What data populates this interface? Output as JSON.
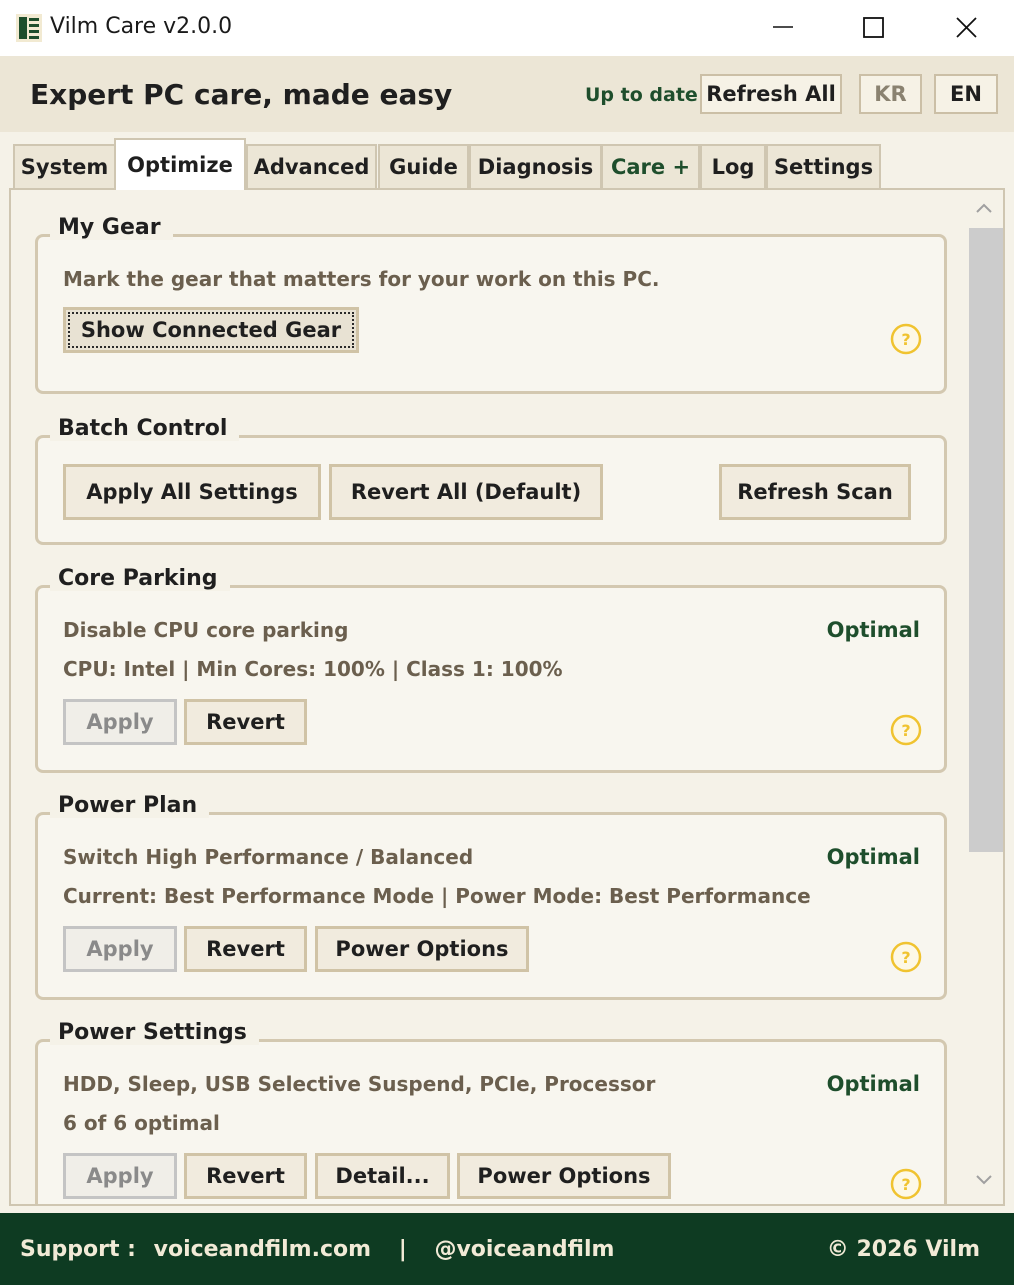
{
  "window": {
    "title": "Vilm Care v2.0.0",
    "app_icon": "vilm-logo-icon",
    "controls": [
      "minimize-icon",
      "maximize-icon",
      "close-icon"
    ]
  },
  "header": {
    "tagline": "Expert PC care, made easy",
    "status": "Up to date",
    "refresh_label": "Refresh All",
    "lang_kr": "KR",
    "lang_en": "EN"
  },
  "tabs": [
    {
      "label": "System",
      "active": false
    },
    {
      "label": "Optimize",
      "active": true
    },
    {
      "label": "Advanced",
      "active": false
    },
    {
      "label": "Guide",
      "active": false
    },
    {
      "label": "Diagnosis",
      "active": false
    },
    {
      "label": "Care +",
      "active": false
    },
    {
      "label": "Log",
      "active": false
    },
    {
      "label": "Settings",
      "active": false
    }
  ],
  "sections": {
    "my_gear": {
      "title": "My Gear",
      "description": "Mark the gear that matters for your work on this PC.",
      "button": "Show Connected Gear"
    },
    "batch": {
      "title": "Batch Control",
      "apply_all": "Apply All Settings",
      "revert_all": "Revert All (Default)",
      "refresh_scan": "Refresh Scan"
    },
    "core_parking": {
      "title": "Core Parking",
      "description": "Disable CPU core parking",
      "detail": "CPU: Intel | Min Cores: 100% | Class 1: 100%",
      "status": "Optimal",
      "apply": "Apply",
      "revert": "Revert"
    },
    "power_plan": {
      "title": "Power Plan",
      "description": "Switch High Performance / Balanced",
      "detail": "Current: Best Performance Mode | Power Mode: Best Performance",
      "status": "Optimal",
      "apply": "Apply",
      "revert": "Revert",
      "power_options": "Power Options"
    },
    "power_settings": {
      "title": "Power Settings",
      "description": "HDD, Sleep, USB Selective Suspend, PCIe, Processor",
      "detail": "6 of 6 optimal",
      "status": "Optimal",
      "apply": "Apply",
      "revert": "Revert",
      "detail_button": "Detail...",
      "power_options": "Power Options"
    }
  },
  "footer": {
    "support_label": "Support :",
    "website": "voiceandfilm.com",
    "separator": "|",
    "handle": "@voiceandfilm",
    "copyright": "© 2026 Vilm"
  },
  "colors": {
    "brand_green": "#0e3b22",
    "status_green": "#1e4e2c",
    "help_icon": "#f0c330",
    "background": "#f5f2e8"
  }
}
